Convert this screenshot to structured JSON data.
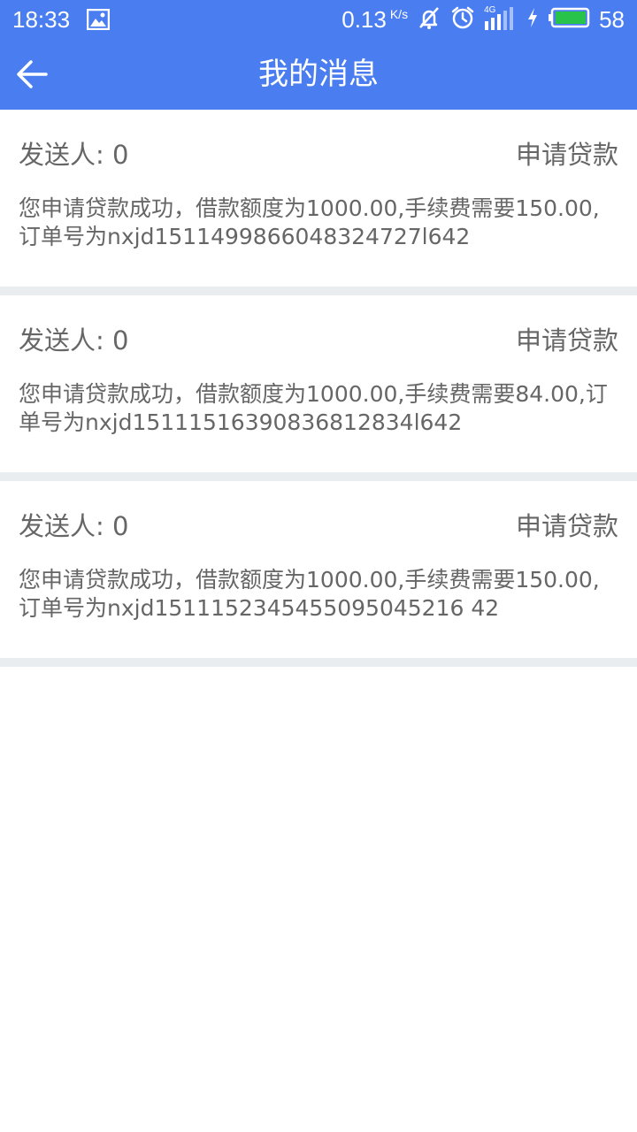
{
  "status_bar": {
    "time": "18:33",
    "net_speed": "0.13",
    "net_speed_unit": "K/s",
    "signal_type": "4G",
    "battery_level": "58",
    "icons": [
      "image-notification-icon",
      "bell-muted-icon",
      "alarm-clock-icon",
      "signal-4g-icon",
      "charging-bolt-icon",
      "battery-icon"
    ]
  },
  "app_bar": {
    "title": "我的消息",
    "back_icon": "arrow-left-icon"
  },
  "messages": [
    {
      "sender": "发送人: 0",
      "type": "申请贷款",
      "body": "您申请贷款成功，借款额度为1000.00,手续费需要150.00,订单号为nxjd1511499866048324727l642"
    },
    {
      "sender": "发送人: 0",
      "type": "申请贷款",
      "body": "您申请贷款成功，借款额度为1000.00,手续费需要84.00,订单号为nxjd15111516390836812834l642"
    },
    {
      "sender": "发送人: 0",
      "type": "申请贷款",
      "body": "您申请贷款成功，借款额度为1000.00,手续费需要150.00,订单号为nxjd1511152345455095045216 42"
    }
  ],
  "colors": {
    "primary": "#4a7ef0",
    "text": "#666666",
    "divider": "#e9edef",
    "background": "#ffffff",
    "battery_fill": "#27c34a"
  }
}
